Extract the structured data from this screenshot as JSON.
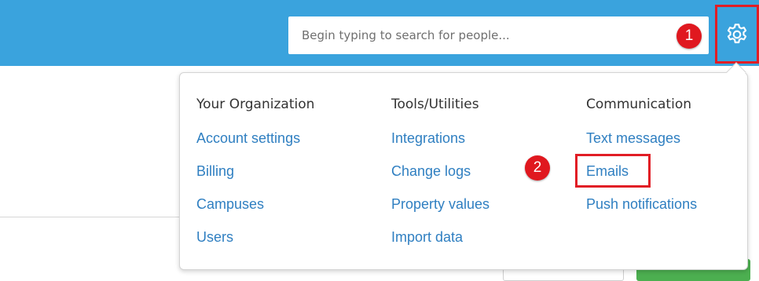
{
  "search": {
    "placeholder": "Begin typing to search for people..."
  },
  "gear": {
    "icon": "gear-icon"
  },
  "annotations": {
    "step1": "1",
    "step2": "2",
    "highlight_color": "#e11d25"
  },
  "colors": {
    "topbar": "#3aa3dd",
    "link": "#2f7fc1",
    "badge": "#e0181f"
  },
  "menu": {
    "columns": [
      {
        "heading": "Your Organization",
        "items": [
          "Account settings",
          "Billing",
          "Campuses",
          "Users"
        ]
      },
      {
        "heading": "Tools/Utilities",
        "items": [
          "Integrations",
          "Change logs",
          "Property values",
          "Import data"
        ]
      },
      {
        "heading": "Communication",
        "items": [
          "Text messages",
          "Emails",
          "Push notifications"
        ]
      }
    ]
  }
}
